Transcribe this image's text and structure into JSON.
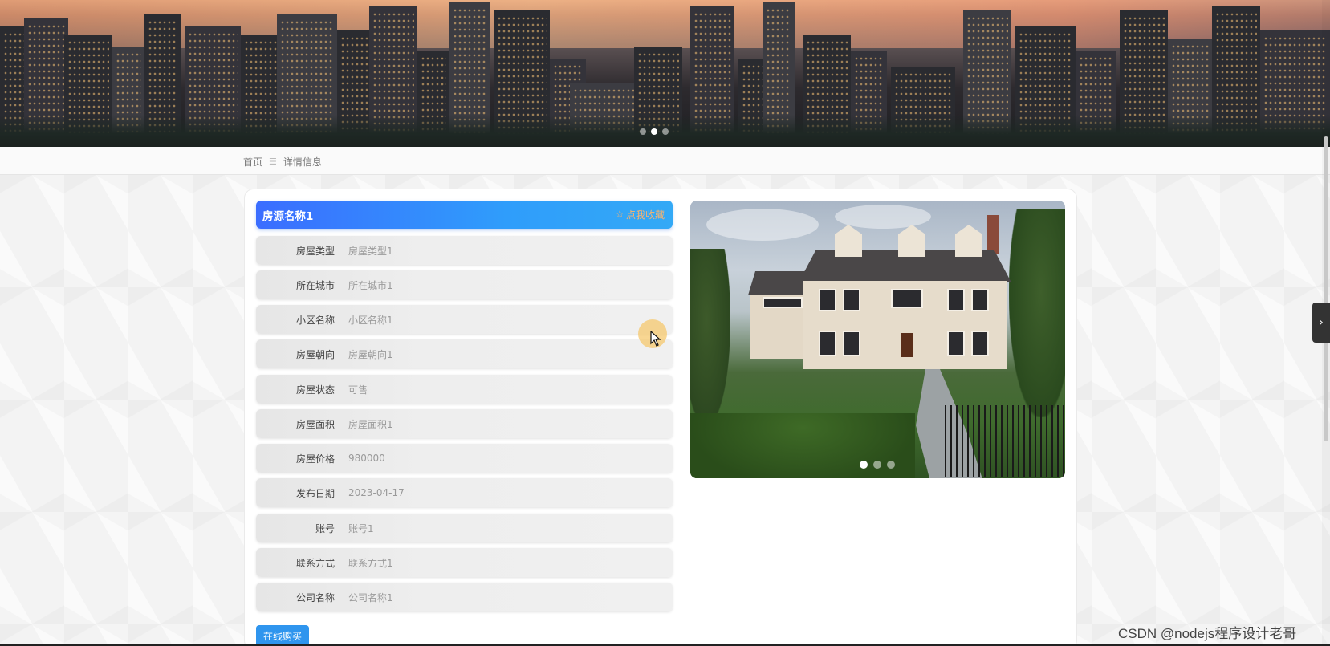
{
  "banner": {
    "slides": 3,
    "active_slide": 2
  },
  "breadcrumb": {
    "home": "首页",
    "separator": "☰",
    "current": "详情信息"
  },
  "detail": {
    "title": "房源名称1",
    "favorite_label": "点我收藏",
    "favorite_icon": "star-outline-icon",
    "fields": [
      {
        "label": "房屋类型",
        "value": "房屋类型1"
      },
      {
        "label": "所在城市",
        "value": "所在城市1"
      },
      {
        "label": "小区名称",
        "value": "小区名称1"
      },
      {
        "label": "房屋朝向",
        "value": "房屋朝向1"
      },
      {
        "label": "房屋状态",
        "value": "可售"
      },
      {
        "label": "房屋面积",
        "value": "房屋面积1"
      },
      {
        "label": "房屋价格",
        "value": "980000"
      },
      {
        "label": "发布日期",
        "value": "2023-04-17"
      },
      {
        "label": "账号",
        "value": "账号1"
      },
      {
        "label": "联系方式",
        "value": "联系方式1"
      },
      {
        "label": "公司名称",
        "value": "公司名称1"
      }
    ],
    "buy_button": "在线购买"
  },
  "gallery": {
    "slides": 3,
    "active_slide": 1
  },
  "side_tab_icon": "chevron-right-icon",
  "watermark": "CSDN @nodejs程序设计老哥",
  "colors": {
    "title_gradient_start": "#3b6dff",
    "title_gradient_end": "#33a9f6",
    "favorite": "#ffb36b",
    "buy_button": "#2f95ee"
  }
}
